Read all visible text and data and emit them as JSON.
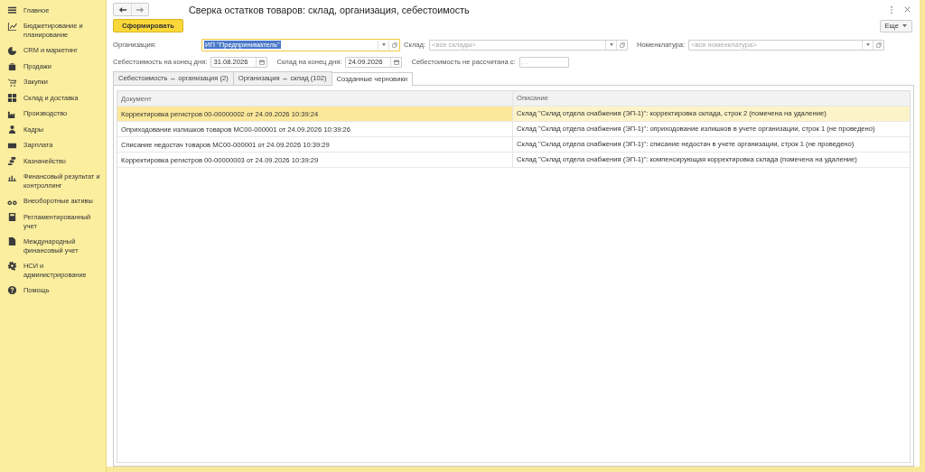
{
  "sidebar": {
    "items": [
      {
        "label": "Главное"
      },
      {
        "label": "Бюджетирование и планирование"
      },
      {
        "label": "CRM и маркетинг"
      },
      {
        "label": "Продажи"
      },
      {
        "label": "Закупки"
      },
      {
        "label": "Склад и доставка"
      },
      {
        "label": "Производство"
      },
      {
        "label": "Кадры"
      },
      {
        "label": "Зарплата"
      },
      {
        "label": "Казначейство"
      },
      {
        "label": "Финансовый результат и контроллинг"
      },
      {
        "label": "Внеоборотные активы"
      },
      {
        "label": "Регламентированный учет"
      },
      {
        "label": "Международный финансовый учет"
      },
      {
        "label": "НСИ и администрирование"
      },
      {
        "label": "Помощь"
      }
    ]
  },
  "window": {
    "title": "Сверка остатков товаров: склад, организация, себестоимость"
  },
  "form_button": "Сформировать",
  "more_button": "Еще",
  "filters": {
    "organization": {
      "label": "Организация:",
      "value": "ИП \"Предприниматель\""
    },
    "warehouse": {
      "label": "Склад:",
      "placeholder": "<все склады>"
    },
    "nomenclature": {
      "label": "Номенклатура:",
      "placeholder": "<вся номенклатура>"
    },
    "cost_date": {
      "label": "Себестоимость на конец дня:",
      "value": "31.08.2026"
    },
    "warehouse_date": {
      "label": "Склад на конец дня:",
      "value": "24.09.2026"
    },
    "not_calculated": {
      "label": "Себестоимость не рассчитана с:",
      "placeholder": ". ."
    }
  },
  "tabs": [
    {
      "label": "Себестоимость ↔ организация (2)",
      "selected": false
    },
    {
      "label": "Организация ↔ склад (102)",
      "selected": false
    },
    {
      "label": "Созданные черновики",
      "selected": true
    }
  ],
  "table": {
    "columns": [
      "Документ",
      "Описание"
    ],
    "rows": [
      {
        "document": "Корректировка регистров 00-00000002 от 24.09.2026 10:39:24",
        "description": "Склад \"Склад отдела снабжения (ЭП-1)\": корректировка склада, строк 2 (помечена на удаление)",
        "selected": true
      },
      {
        "document": "Оприходование излишков товаров МС00-000001 от 24.09.2026 10:39:26",
        "description": "Склад \"Склад отдела снабжения (ЭП-1)\": оприходование излишков в учете организации, строк 1 (не проведено)",
        "selected": false
      },
      {
        "document": "Списание недостач товаров МС00-000001 от 24.09.2026 10:39:29",
        "description": "Склад \"Склад отдела снабжения (ЭП-1)\": списание недостач в учете организации, строк 1 (не проведено)",
        "selected": false
      },
      {
        "document": "Корректировка регистров 00-00000003 от 24.09.2026 10:39:29",
        "description": "Склад \"Склад отдела снабжения (ЭП-1)\": компенсирующая корректировка склада (помечена на удаление)",
        "selected": false
      }
    ]
  }
}
